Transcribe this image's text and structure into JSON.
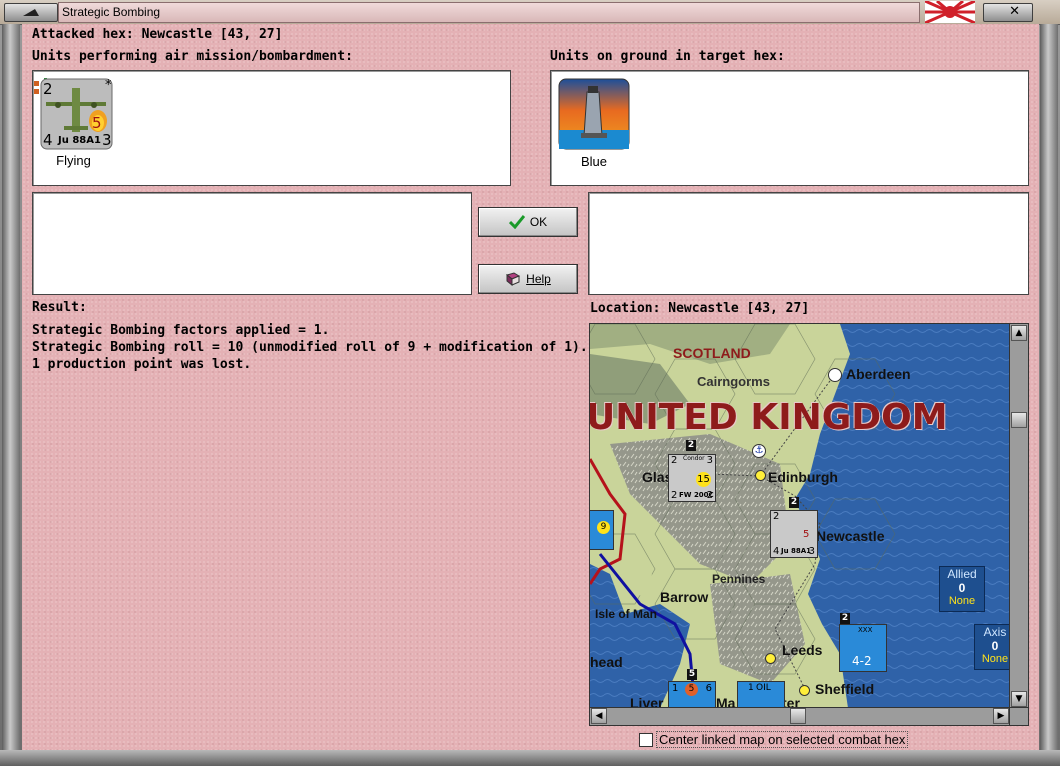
{
  "window": {
    "title": "Strategic Bombing"
  },
  "attack": {
    "attacked_hex_label": "Attacked hex:",
    "attacked_hex_value": "Newcastle  [43, 27]",
    "air_units_label": "Units performing air mission/bombardment:",
    "ground_units_label": "Units on ground in target hex:",
    "air_unit": {
      "name": "Ju 88A1",
      "top_left": "2",
      "bottom_left": "4",
      "bottom_right": "3",
      "strength": "5",
      "star": "*",
      "status": "Flying"
    },
    "ground_unit": {
      "status": "Blue"
    }
  },
  "buttons": {
    "ok_label": "OK",
    "help_label": "Help"
  },
  "result": {
    "label": "Result:",
    "lines": [
      "Strategic Bombing factors applied = 1.",
      "Strategic Bombing roll = 10 (unmodified roll of 9 + modification of 1).",
      "1 production point was lost."
    ]
  },
  "location": {
    "label": "Location:",
    "value": "Newcastle  [43, 27]"
  },
  "map": {
    "country": "UNITED KINGDOM",
    "region": "SCOTLAND",
    "places": [
      "Cairngorms",
      "Aberdeen",
      "Edinburgh",
      "Glasgow",
      "Newcastle",
      "Pennines",
      "Barrow",
      "Isle of Man",
      "Leeds",
      "Sheffield",
      "head",
      "Liver",
      "Ma",
      "ter"
    ],
    "units": [
      {
        "name": "FW 200C",
        "label": "Condor",
        "top_left": "2",
        "top_right": "3",
        "bottom_left": "2",
        "bottom_right": "2",
        "strength": "15",
        "stack": "2"
      },
      {
        "name": "Ju 88A1",
        "top_left": "2",
        "bottom_left": "4",
        "bottom_right": "3",
        "strength": "5",
        "stack": "2"
      },
      {
        "name": "4-2",
        "label": "XXX",
        "stack": "2"
      },
      {
        "name": "9"
      },
      {
        "name": "OIL",
        "value": "1"
      },
      {
        "strength": "5",
        "left": "1",
        "right": "6",
        "stack": "5"
      }
    ],
    "allied_box": {
      "label": "Allied",
      "value": "0",
      "status": "None"
    },
    "axis_box": {
      "label": "Axis",
      "value": "0",
      "status": "None"
    }
  },
  "options": {
    "center_map_label": "Center linked map on selected combat hex"
  },
  "colors": {
    "client_bg": "#e4b1b5",
    "sea": "#2f62a8",
    "land": "#c9d49a",
    "country_label": "#8e1b1b"
  }
}
